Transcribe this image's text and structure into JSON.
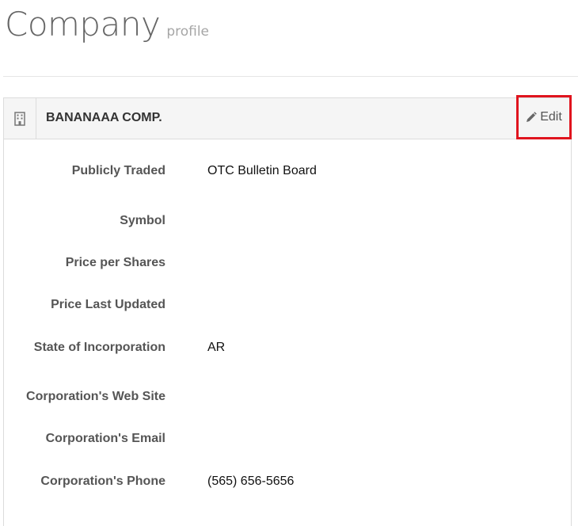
{
  "page": {
    "title": "Company",
    "subtitle": "profile"
  },
  "panel": {
    "icon": "building-icon",
    "company_name": "BANANAAA COMP.",
    "edit_label": "Edit",
    "edit_icon": "pencil-icon",
    "highlight_color": "#e0141e"
  },
  "fields": {
    "publicly_traded": {
      "label": "Publicly Traded",
      "value": "OTC Bulletin Board"
    },
    "symbol": {
      "label": "Symbol",
      "value": ""
    },
    "price_per_shares": {
      "label": "Price per Shares",
      "value": ""
    },
    "price_last_updated": {
      "label": "Price Last Updated",
      "value": ""
    },
    "state_of_incorporation": {
      "label": "State of Incorporation",
      "value": "AR"
    },
    "web_site": {
      "label": "Corporation's Web Site",
      "value": ""
    },
    "email": {
      "label": "Corporation's Email",
      "value": ""
    },
    "phone": {
      "label": "Corporation's Phone",
      "value": "(565) 656-5656"
    }
  }
}
